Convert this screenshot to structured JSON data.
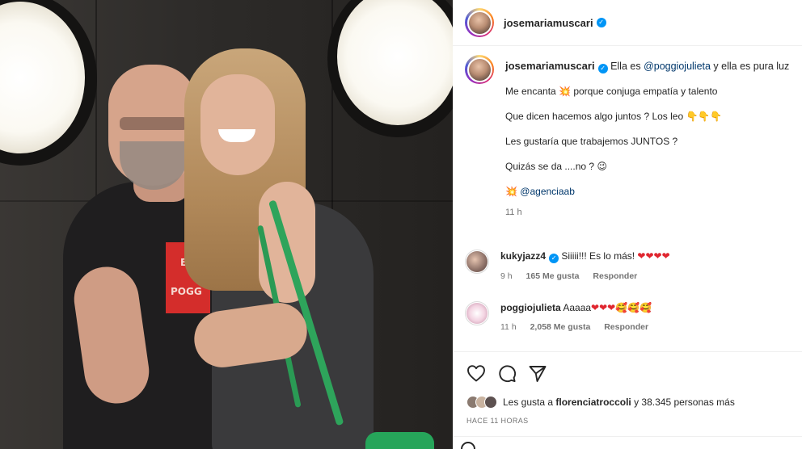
{
  "header": {
    "username": "josemariamuscari",
    "verified": true
  },
  "caption": {
    "username": "josemariamuscari",
    "first_line_pre": "Ella es ",
    "mention": "@poggiojulieta",
    "first_line_post": " y ella es pura luz",
    "line2_pre": "Me encanta ",
    "line2_emoji": "💥",
    "line2_post": " porque conjuga empatía y talento",
    "line3_pre": "Que dicen hacemos algo juntos ? Los leo ",
    "line3_emoji": "👇👇👇",
    "line4": "Les gustaría que trabajemos JUNTOS ?",
    "line5_pre": "Quizás se da ....no ? ",
    "line5_emoji": "😉",
    "line6_emoji": "💥",
    "line6_mention": "@agenciaab",
    "time": "11 h"
  },
  "comments": [
    {
      "username": "kukyjazz4",
      "verified": true,
      "text": "Siiiii!!! Es lo más! ",
      "emoji": "❤❤❤❤",
      "time": "9 h",
      "likes": "165 Me gusta",
      "reply": "Responder"
    },
    {
      "username": "poggiojulieta",
      "verified": false,
      "text": "Aaaaa",
      "emoji": "❤❤❤🥰🥰🥰",
      "time": "11 h",
      "likes": "2,058 Me gusta",
      "reply": "Responder"
    }
  ],
  "actions": {
    "icons": [
      "heart-icon",
      "comment-icon",
      "share-icon"
    ]
  },
  "likes": {
    "prefix": "Les gusta a ",
    "user": "florenciatroccoli",
    "suffix": " y 38.345 personas más"
  },
  "time_ago": "HACE 11 HORAS",
  "photo": {
    "shirt_logo_line1": "B",
    "shirt_logo_line2": "POGG"
  },
  "colors": {
    "verified": "#0095f6",
    "mention": "#00376b",
    "heart": "#e0262f",
    "meta": "#737373"
  }
}
